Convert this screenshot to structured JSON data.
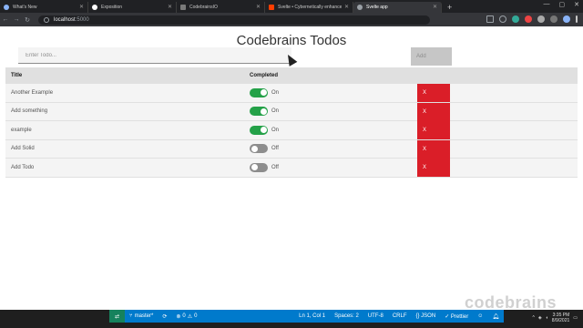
{
  "browser": {
    "tabs": [
      {
        "label": "What's New",
        "icon": "whats-new-icon",
        "color": "#8ab4f8",
        "active": false
      },
      {
        "label": "Exposition",
        "icon": "exposition-icon",
        "color": "#ffffff",
        "active": false
      },
      {
        "label": "CodebrainsIO",
        "icon": "codebrains-icon",
        "color": "#7a7a7a",
        "active": false
      },
      {
        "label": "Svelte • Cybernetically enhanced",
        "icon": "svelte-icon",
        "color": "#ff3e00",
        "active": false
      },
      {
        "label": "Svelte app",
        "icon": "svelte-app-icon",
        "color": "#9aa0a6",
        "active": true
      }
    ],
    "new_tab": "+",
    "url_host": "localhost",
    "url_port": ":5000"
  },
  "app": {
    "title": "Codebrains Todos",
    "input_placeholder": "Enter Todo...",
    "add_label": "Add",
    "headers": {
      "title": "Title",
      "completed": "Completed"
    },
    "todos": [
      {
        "title": "Another Example",
        "completed": true,
        "state_label": "On",
        "delete_label": "X"
      },
      {
        "title": "Add something",
        "completed": true,
        "state_label": "On",
        "delete_label": "X"
      },
      {
        "title": "example",
        "completed": true,
        "state_label": "On",
        "delete_label": "X"
      },
      {
        "title": "Add Solid",
        "completed": false,
        "state_label": "Off",
        "delete_label": "X"
      },
      {
        "title": "Add Todo",
        "completed": false,
        "state_label": "Off",
        "delete_label": "X"
      }
    ]
  },
  "statusbar": {
    "branch": "master*",
    "errors": "0",
    "warnings": "0",
    "position": "Ln 1, Col 1",
    "spaces": "Spaces: 2",
    "encoding": "UTF-8",
    "eol": "CRLF",
    "language": "{} JSON",
    "prettier": "✓ Prettier"
  },
  "watermark": "codebrains",
  "tray": {
    "time": "3:35 PM",
    "date": "8/9/2021"
  },
  "colors": {
    "toggle_on": "#24a148",
    "toggle_off": "#8d8d8d",
    "delete": "#da1e28",
    "status_bar": "#007acc"
  }
}
